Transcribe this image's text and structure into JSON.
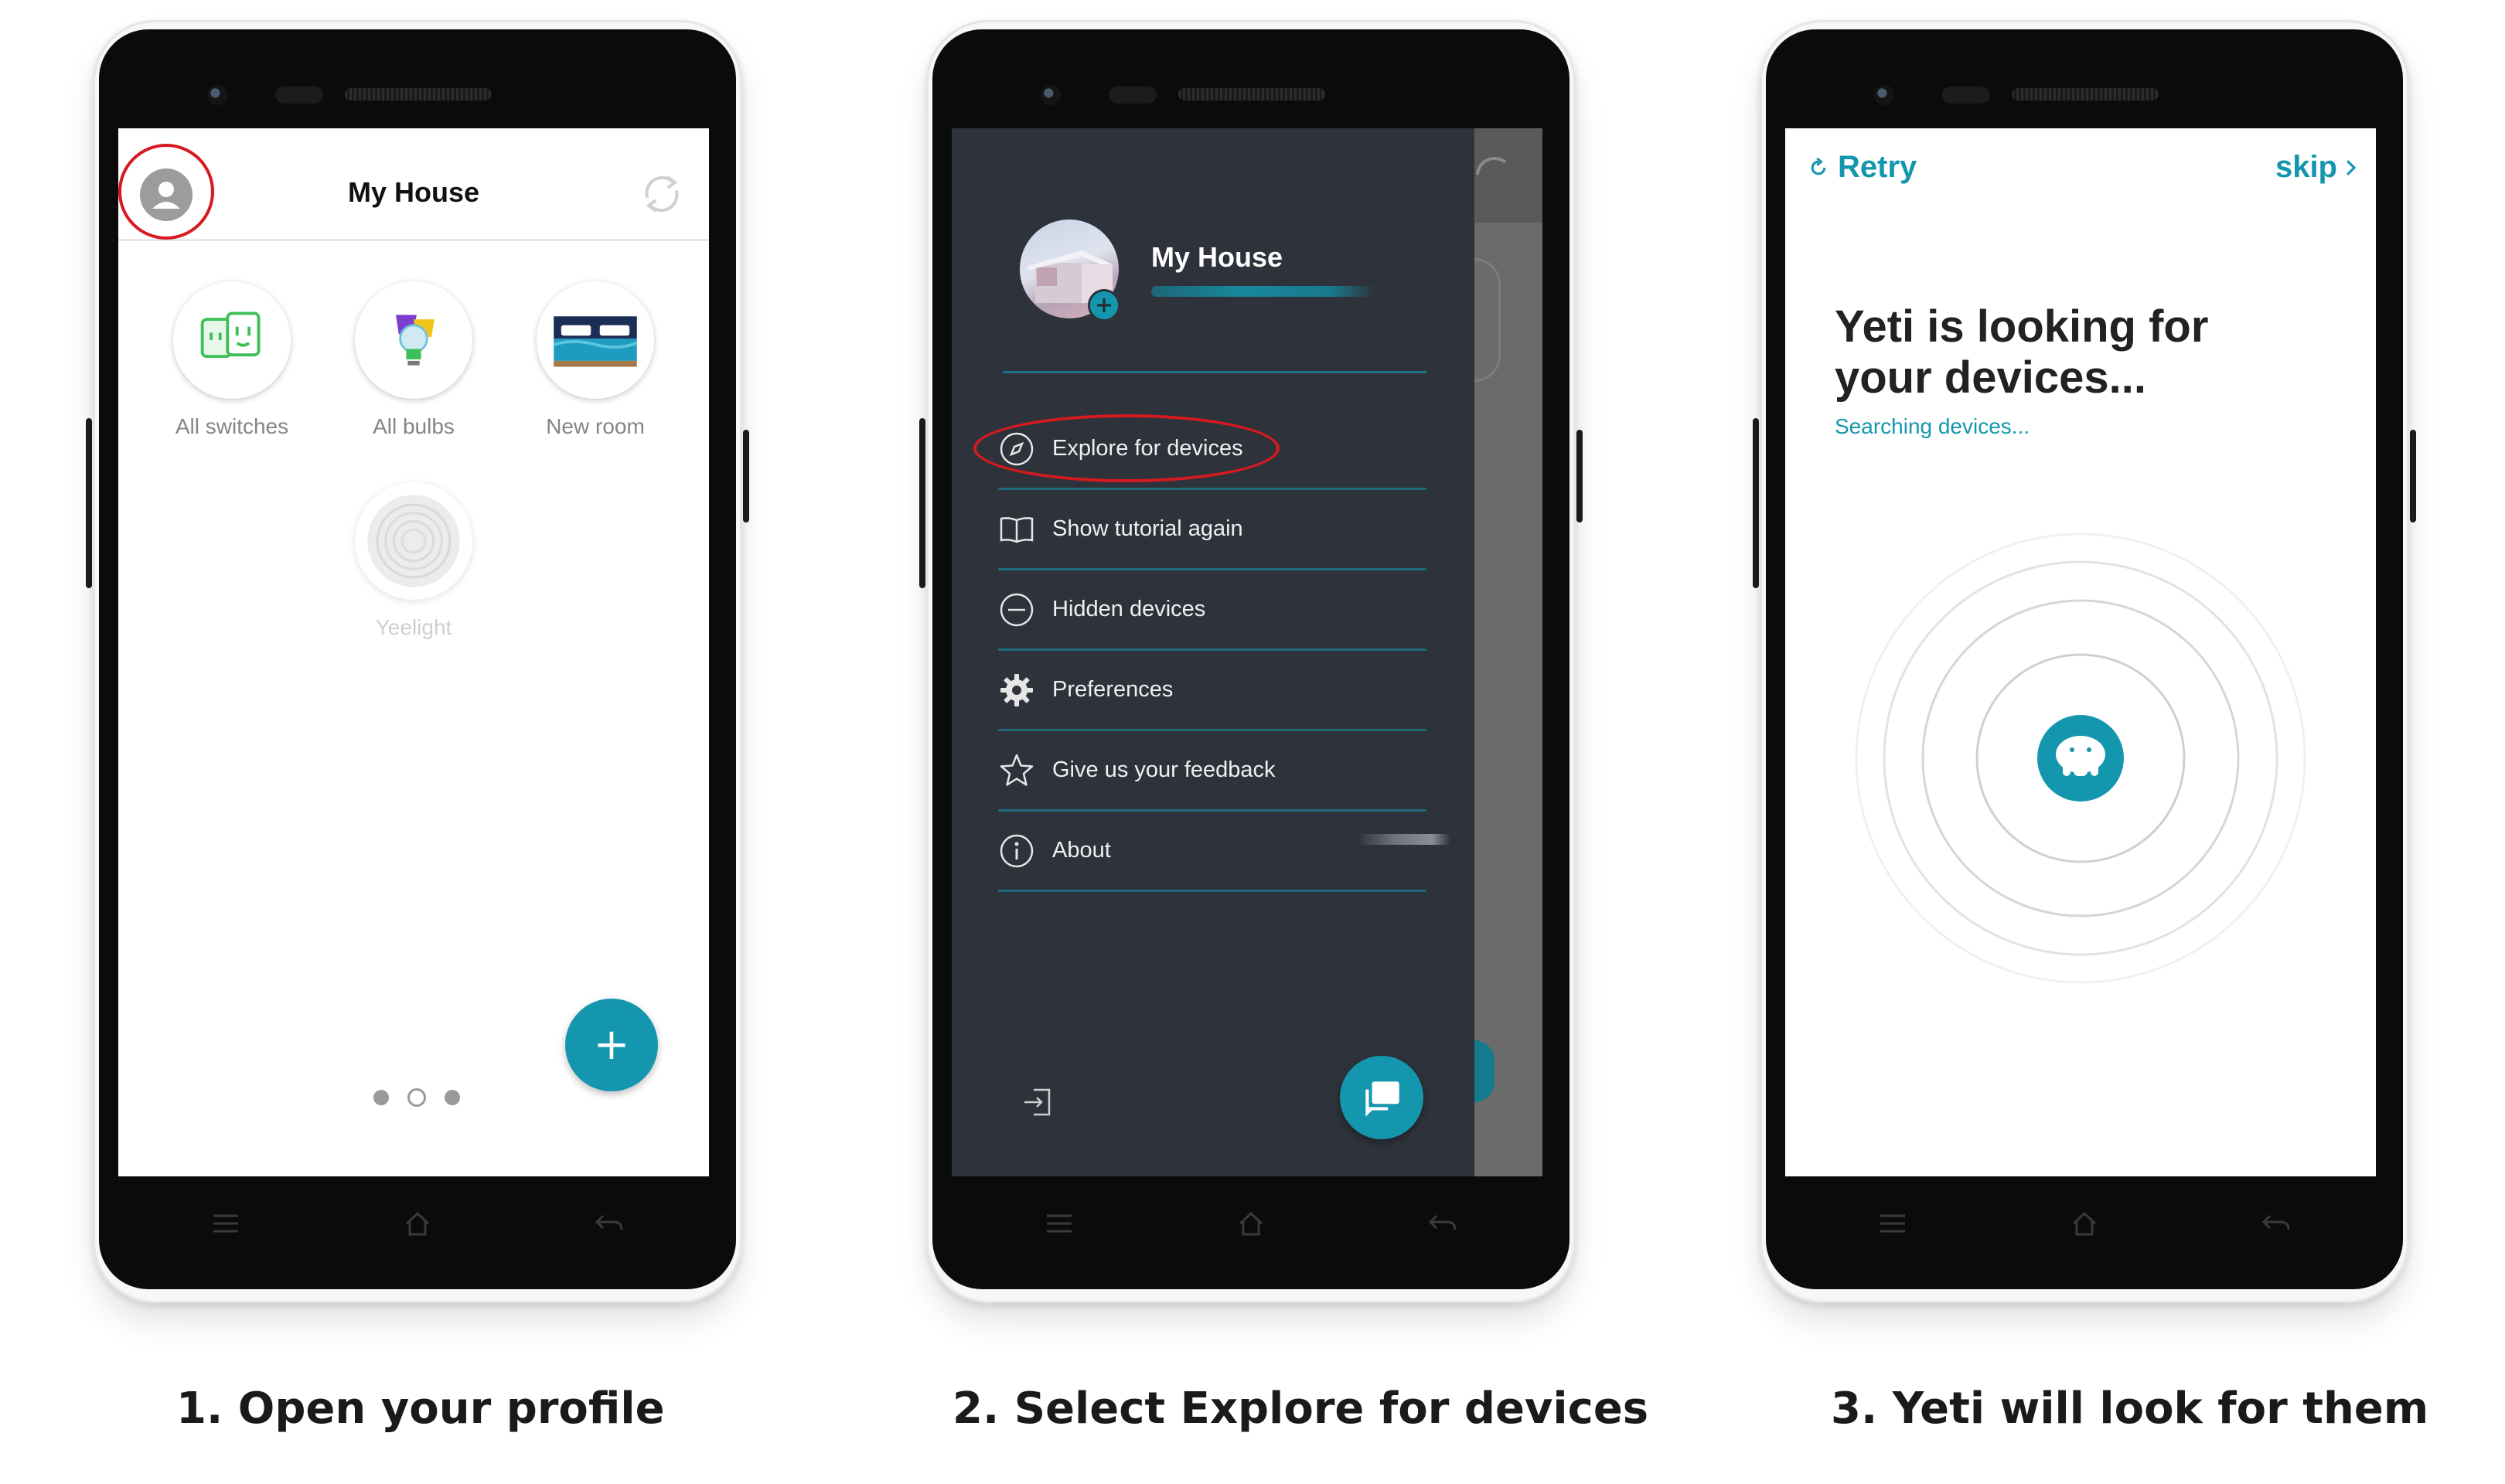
{
  "captions": {
    "step1": "1. Open your profile",
    "step2": "2. Select Explore for devices",
    "step3": "3. Yeti will look for them"
  },
  "screen1": {
    "title": "My House",
    "tiles": [
      {
        "label": "All switches",
        "icon": "switch-icon"
      },
      {
        "label": "All bulbs",
        "icon": "bulb-icon"
      },
      {
        "label": "New room",
        "icon": "bed-icon"
      },
      {
        "label": "Yeelight",
        "icon": "yeelight-icon"
      }
    ],
    "fab_label": "+",
    "page_dots": {
      "count": 3,
      "active": 2
    }
  },
  "screen2": {
    "title": "My House",
    "menu": [
      {
        "label": "Explore for devices",
        "icon": "compass-icon"
      },
      {
        "label": "Show tutorial again",
        "icon": "book-icon"
      },
      {
        "label": "Hidden devices",
        "icon": "minus-circle-icon"
      },
      {
        "label": "Preferences",
        "icon": "gear-icon"
      },
      {
        "label": "Give us your feedback",
        "icon": "star-icon"
      },
      {
        "label": "About",
        "icon": "info-icon"
      }
    ]
  },
  "screen3": {
    "retry_label": "Retry",
    "skip_label": "skip",
    "heading": "Yeti is looking for your devices...",
    "status": "Searching devices..."
  },
  "colors": {
    "accent": "#1497ae",
    "drawer": "#2e323a",
    "highlight": "#d71920"
  }
}
